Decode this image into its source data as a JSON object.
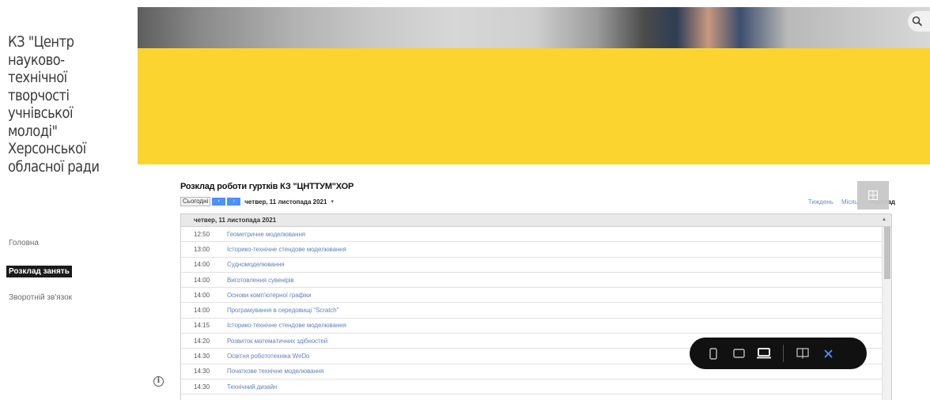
{
  "site": {
    "title": "КЗ \"Центр науково-технічної творчості учнівської молоді\" Херсонської обласної ради"
  },
  "nav": {
    "items": [
      {
        "label": "Головна",
        "active": false
      },
      {
        "label": "Розклад занять",
        "active": true
      },
      {
        "label": "Зворотній зв'язок",
        "active": false
      }
    ]
  },
  "calendar": {
    "title": "Розклад роботи гуртків КЗ \"ЦНТТУМ\"ХОР",
    "today_label": "Сьогодні",
    "prev_arrow": "‹",
    "next_arrow": "›",
    "current_date": "четвер, 11 листопада 2021",
    "date_caret": "▾",
    "views": [
      {
        "label": "Тиждень",
        "active": false
      },
      {
        "label": "Місяць",
        "active": false
      },
      {
        "label": "Розклад",
        "active": true
      }
    ],
    "day_header": "четвер, 11 листопада 2021",
    "events": [
      {
        "time": "12:50",
        "title": "Геометричне моделювання"
      },
      {
        "time": "13:00",
        "title": "Історико-технічне стендове моделювання"
      },
      {
        "time": "14:00",
        "title": "Судномоделювання"
      },
      {
        "time": "14:00",
        "title": "Виготовлення сувенірів"
      },
      {
        "time": "14:00",
        "title": "Основи комп'ютерної графіки"
      },
      {
        "time": "14:00",
        "title": "Програмування в середовищі \"Scratch\""
      },
      {
        "time": "14:15",
        "title": "Історико-технічне стендове моделювання"
      },
      {
        "time": "14:20",
        "title": "Розвиток математичних здібностей"
      },
      {
        "time": "14:30",
        "title": "Освітня робототехніка WeDo"
      },
      {
        "time": "14:30",
        "title": "Початкове технічне моделювання"
      },
      {
        "time": "14:30",
        "title": "Технічний дизайн"
      }
    ]
  },
  "icons": {
    "search": "search-icon",
    "info": "info-icon",
    "grid_toggle": "grid-icon",
    "device_phone": "phone-icon",
    "device_tablet": "tablet-icon",
    "device_laptop": "laptop-icon",
    "book": "book-icon",
    "close": "close-icon"
  },
  "colors": {
    "banner_yellow": "#fbd430",
    "link_blue": "#6683bf",
    "nav_active_bg": "#1a1a1a",
    "device_bar_bg": "#111111",
    "close_accent": "#4d90fe"
  },
  "info_glyph": "i"
}
